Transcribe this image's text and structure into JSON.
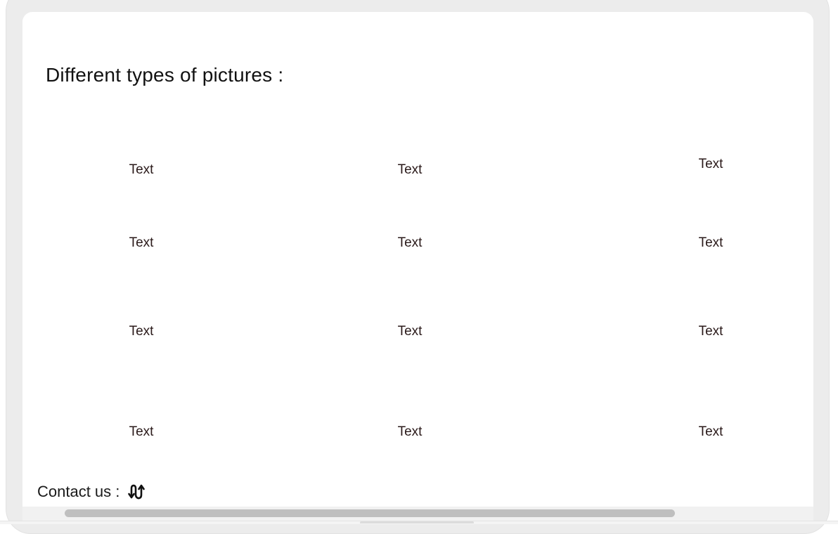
{
  "page": {
    "title": "Different types of pictures :"
  },
  "gallery": {
    "rows": [
      [
        "Text",
        "Text",
        "Text"
      ],
      [
        "Text",
        "Text",
        "Text"
      ],
      [
        "Text",
        "Text",
        "Text"
      ],
      [
        "Text",
        "Text",
        "Text"
      ]
    ]
  },
  "footer": {
    "contact_label": "Contact us :",
    "contact_icon": "swap-vertical-icon"
  },
  "colors": {
    "frame": "#ececec",
    "screen": "#ffffff",
    "scroll_thumb": "#bfbfbf",
    "text": "#2a1a1a"
  }
}
